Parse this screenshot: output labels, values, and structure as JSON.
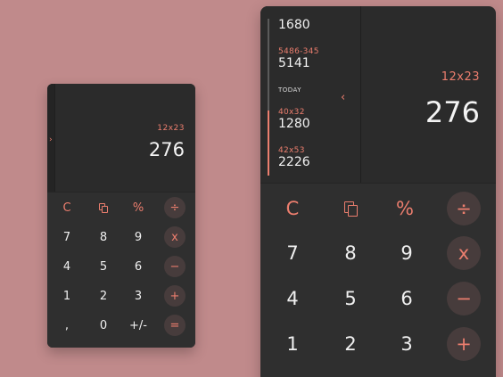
{
  "small": {
    "side_arrow": "›",
    "expression": "12x23",
    "result": "276",
    "keys": {
      "clear": "C",
      "percent": "%",
      "divide": "÷",
      "seven": "7",
      "eight": "8",
      "nine": "9",
      "multiply": "x",
      "four": "4",
      "five": "5",
      "six": "6",
      "minus": "−",
      "one": "1",
      "two": "2",
      "three": "3",
      "plus": "+",
      "comma": ",",
      "zero": "0",
      "plus_minus": "+/-",
      "equals": "="
    }
  },
  "large": {
    "history": {
      "items": [
        {
          "expr": "",
          "value": "1680"
        },
        {
          "expr": "5486-345",
          "value": "5141"
        },
        {
          "expr": "40x32",
          "value": "1280"
        },
        {
          "expr": "42x53",
          "value": "2226"
        }
      ],
      "today_label": "TODAY",
      "collapse_arrow": "‹"
    },
    "expression": "12x23",
    "result": "276",
    "keys": {
      "clear": "C",
      "percent": "%",
      "divide": "÷",
      "seven": "7",
      "eight": "8",
      "nine": "9",
      "multiply": "x",
      "four": "4",
      "five": "5",
      "six": "6",
      "minus": "−",
      "one": "1",
      "two": "2",
      "three": "3",
      "plus": "+"
    }
  },
  "colors": {
    "background": "#c08a8b",
    "panel": "#2b2b2b",
    "keypad": "#2f2f2f",
    "accent": "#ec7e6e",
    "operator_circle": "#473c3c",
    "text": "#f3f3f3"
  },
  "icons": {
    "copy": "copy-icon",
    "expand": "chevron-right-icon",
    "collapse": "chevron-left-icon"
  }
}
